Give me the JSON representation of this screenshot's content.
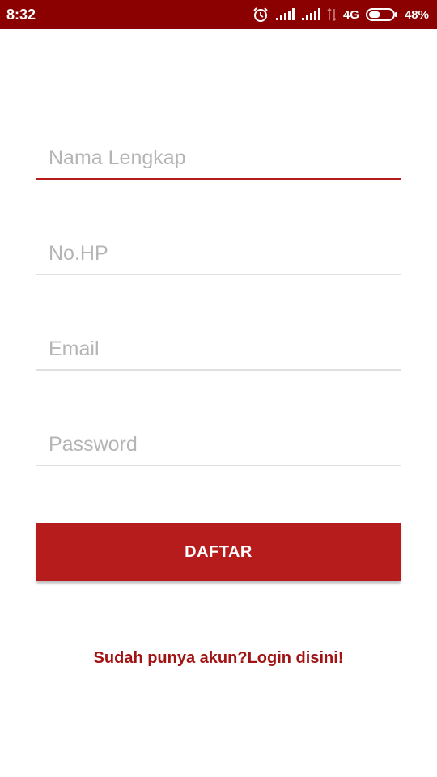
{
  "status_bar": {
    "time": "8:32",
    "network": "4G",
    "battery_percent": "48%",
    "battery_level": 0.48,
    "icons": [
      "alarm-icon",
      "signal-1-icon",
      "signal-2-icon",
      "data-arrows-icon",
      "battery-icon"
    ]
  },
  "form": {
    "full_name": {
      "placeholder": "Nama Lengkap",
      "value": ""
    },
    "phone": {
      "placeholder": "No.HP",
      "value": ""
    },
    "email": {
      "placeholder": "Email",
      "value": ""
    },
    "password": {
      "placeholder": "Password",
      "value": ""
    },
    "submit_label": "DAFTAR"
  },
  "login_link": "Sudah punya akun?Login disini!",
  "colors": {
    "status_bar": "#8b0000",
    "accent": "#b71c1c",
    "link": "#a21414",
    "placeholder": "#b5b5b5",
    "divider": "#e0e0e0"
  }
}
